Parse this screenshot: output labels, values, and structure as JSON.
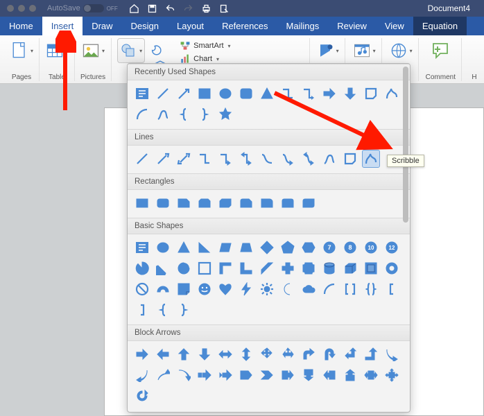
{
  "titlebar": {
    "autosave_label": "AutoSave",
    "autosave_state": "OFF",
    "doc_title": "Document4"
  },
  "tabs": {
    "home": "Home",
    "insert": "Insert",
    "draw": "Draw",
    "design": "Design",
    "layout": "Layout",
    "references": "References",
    "mailings": "Mailings",
    "review": "Review",
    "view": "View",
    "equation": "Equation"
  },
  "ribbon": {
    "pages": "Pages",
    "table": "Table",
    "pictures": "Pictures",
    "smartart": "SmartArt",
    "chart": "Chart",
    "comment": "Comment",
    "header_partial": "H"
  },
  "shapes_panel": {
    "categories": {
      "recent": "Recently Used Shapes",
      "lines": "Lines",
      "rectangles": "Rectangles",
      "basic": "Basic Shapes",
      "block_arrows": "Block Arrows"
    },
    "hovered_tool": "Scribble",
    "numbered_shapes": {
      "s7": "7",
      "s8": "8",
      "s10": "10",
      "s12": "12"
    }
  }
}
